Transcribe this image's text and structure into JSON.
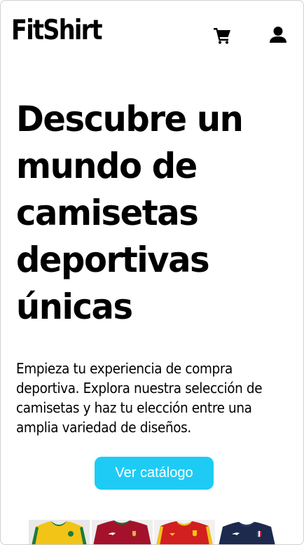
{
  "header": {
    "logo_text": "FitShirt",
    "cart_icon": "shopping-cart-icon",
    "user_icon": "user-account-icon"
  },
  "hero": {
    "title": "Descubre un mundo de camisetas deportivas únicas",
    "subtitle": "Empieza tu experiencia de compra deportiva. Explora nuestra selección de camisetas y haz tu elección entre una amplia variedad de diseños.",
    "cta_label": "Ver catálogo"
  },
  "gallery": {
    "items": [
      {
        "name": "brazil-jersey",
        "color": "#f2c417"
      },
      {
        "name": "portugal-jersey",
        "color": "#a3122a"
      },
      {
        "name": "spain-jersey",
        "color": "#d21f1f"
      },
      {
        "name": "france-jersey",
        "color": "#1d2a4e"
      }
    ]
  },
  "colors": {
    "accent": "#1ecbf5",
    "text": "#000000",
    "background": "#ffffff"
  }
}
